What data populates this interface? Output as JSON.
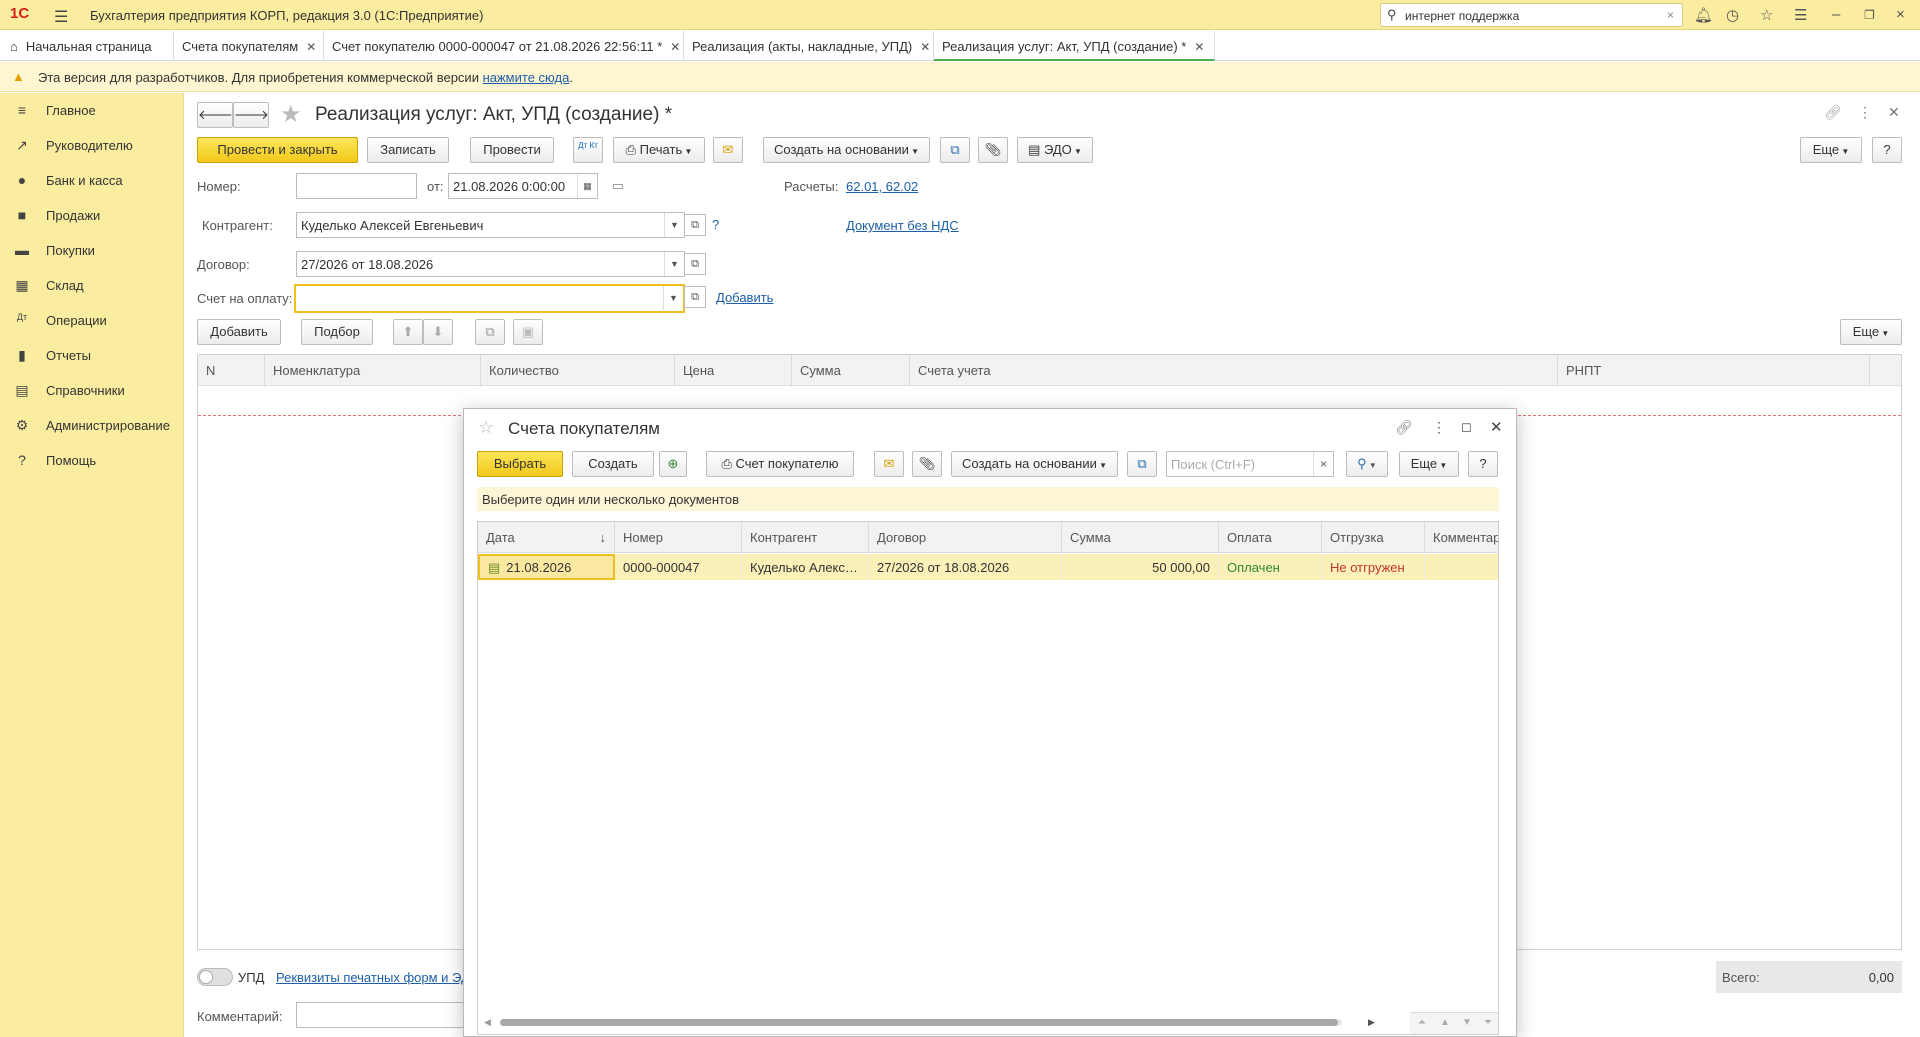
{
  "titlebar": {
    "logo": "1С",
    "title": "Бухгалтерия предприятия КОРП, редакция 3.0  (1С:Предприятие)",
    "search_value": "интернет поддержка"
  },
  "tabs": [
    {
      "label": "Начальная страница"
    },
    {
      "label": "Счета покупателям"
    },
    {
      "label": "Счет покупателю 0000-000047 от 21.08.2026 22:56:11 *"
    },
    {
      "label": "Реализация (акты, накладные, УПД)"
    },
    {
      "label": "Реализация услуг: Акт, УПД (создание) *"
    }
  ],
  "warning": {
    "text": "Эта версия для разработчиков. Для приобретения коммерческой версии ",
    "link": "нажмите сюда",
    "tail": "."
  },
  "sidebar": {
    "items": [
      {
        "label": "Главное",
        "icon": "menu-icon"
      },
      {
        "label": "Руководителю",
        "icon": "trend-icon"
      },
      {
        "label": "Банк и касса",
        "icon": "bank-icon"
      },
      {
        "label": "Продажи",
        "icon": "bag-icon"
      },
      {
        "label": "Покупки",
        "icon": "cart-icon"
      },
      {
        "label": "Склад",
        "icon": "grid-icon"
      },
      {
        "label": "Операции",
        "icon": "dtkt-icon"
      },
      {
        "label": "Отчеты",
        "icon": "chart-icon"
      },
      {
        "label": "Справочники",
        "icon": "book-icon"
      },
      {
        "label": "Администрирование",
        "icon": "gear-icon"
      },
      {
        "label": "Помощь",
        "icon": "help-icon"
      }
    ]
  },
  "form": {
    "title": "Реализация услуг: Акт, УПД (создание) *",
    "toolbar": {
      "post_close": "Провести и закрыть",
      "save": "Записать",
      "post": "Провести",
      "dtkt": "Дт Кт",
      "print": "Печать",
      "create_based": "Создать на основании",
      "edo": "ЭДО",
      "more": "Еще",
      "help": "?"
    },
    "number_label": "Номер:",
    "number_value": "",
    "date_label": "от:",
    "date_value": "21.08.2026  0:00:00",
    "calc_label": "Расчеты:",
    "calc_link": "62.01, 62.02",
    "contractor_label": "Контрагент:",
    "contractor_value": "Куделько Алексей Евгеньевич",
    "help_q": "?",
    "no_vat_link": "Документ без НДС",
    "contract_label": "Договор:",
    "contract_value": "27/2026 от 18.08.2026",
    "invoice_label": "Счет на оплату:",
    "invoice_value": "",
    "add_link": "Добавить",
    "table_toolbar": {
      "add": "Добавить",
      "pick": "Подбор",
      "more": "Еще"
    },
    "columns": [
      "N",
      "Номенклатура",
      "Количество",
      "Цена",
      "Сумма",
      "Счета учета",
      "РНПТ"
    ],
    "upd_label": "УПД",
    "print_req_link": "Реквизиты печатных форм и ЭД",
    "total_label": "Всего:",
    "total_value": "0,00",
    "comment_label": "Комментарий:"
  },
  "modal": {
    "title": "Счета покупателям",
    "toolbar": {
      "select": "Выбрать",
      "create": "Создать",
      "invoice": "Счет покупателю",
      "create_based": "Создать на основании",
      "search_placeholder": "Поиск (Ctrl+F)",
      "more": "Еще",
      "help": "?"
    },
    "hint": "Выберите один или несколько документов",
    "columns": [
      "Дата",
      "Номер",
      "Контрагент",
      "Договор",
      "Сумма",
      "Оплата",
      "Отгрузка",
      "Комментарий"
    ],
    "rows": [
      {
        "date": "21.08.2026",
        "number": "0000-000047",
        "contractor": "Куделько Алексей Евгеньевич",
        "contract": "27/2026 от 18.08.2026",
        "sum": "50 000,00",
        "payment": "Оплачен",
        "shipment": "Не отгружен",
        "comment": ""
      }
    ]
  },
  "colors": {
    "accent_yellow": "#f5d12a",
    "sidebar_bg": "#fbeda0",
    "paid_green": "#2e8b2e",
    "not_shipped_red": "#c0392b",
    "link_blue": "#1d5fa8"
  }
}
